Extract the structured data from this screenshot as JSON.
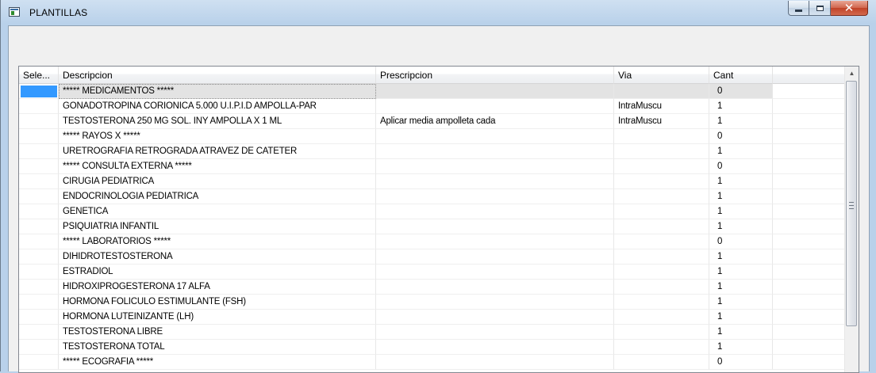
{
  "window": {
    "title": "PLANTILLAS",
    "icon": "application-window-icon",
    "controls": {
      "minimize": "minimize-icon",
      "maximize": "maximize-icon",
      "close": "close-icon"
    }
  },
  "grid": {
    "columns": [
      "Sele...",
      "Descripcion",
      "Prescripcion",
      "Via",
      "Cant"
    ],
    "selected_row": 0,
    "rows": [
      {
        "descripcion": "*****  MEDICAMENTOS  *****",
        "prescripcion": "",
        "via": "",
        "cant": "0"
      },
      {
        "descripcion": "GONADOTROPINA CORIONICA 5.000 U.I.P.I.D AMPOLLA-PAR",
        "prescripcion": "",
        "via": "IntraMuscu",
        "cant": "1"
      },
      {
        "descripcion": "TESTOSTERONA 250 MG SOL. INY AMPOLLA X 1 ML",
        "prescripcion": "Aplicar media ampolleta cada",
        "via": "IntraMuscu",
        "cant": "1"
      },
      {
        "descripcion": "*****  RAYOS X  *****",
        "prescripcion": "",
        "via": "",
        "cant": "0"
      },
      {
        "descripcion": "URETROGRAFIA RETROGRADA ATRAVEZ DE CATETER",
        "prescripcion": "",
        "via": "",
        "cant": "1"
      },
      {
        "descripcion": "*****  CONSULTA EXTERNA  *****",
        "prescripcion": "",
        "via": "",
        "cant": "0"
      },
      {
        "descripcion": "CIRUGIA PEDIATRICA",
        "prescripcion": "",
        "via": "",
        "cant": "1"
      },
      {
        "descripcion": "ENDOCRINOLOGIA PEDIATRICA",
        "prescripcion": "",
        "via": "",
        "cant": "1"
      },
      {
        "descripcion": "GENETICA",
        "prescripcion": "",
        "via": "",
        "cant": "1"
      },
      {
        "descripcion": "PSIQUIATRIA INFANTIL",
        "prescripcion": "",
        "via": "",
        "cant": "1"
      },
      {
        "descripcion": "*****  LABORATORIOS  *****",
        "prescripcion": "",
        "via": "",
        "cant": "0"
      },
      {
        "descripcion": "DIHIDROTESTOSTERONA",
        "prescripcion": "",
        "via": "",
        "cant": "1"
      },
      {
        "descripcion": "ESTRADIOL",
        "prescripcion": "",
        "via": "",
        "cant": "1"
      },
      {
        "descripcion": "HIDROXIPROGESTERONA 17 ALFA",
        "prescripcion": "",
        "via": "",
        "cant": "1"
      },
      {
        "descripcion": "HORMONA FOLICULO ESTIMULANTE (FSH)",
        "prescripcion": "",
        "via": "",
        "cant": "1"
      },
      {
        "descripcion": "HORMONA LUTEINIZANTE (LH)",
        "prescripcion": "",
        "via": "",
        "cant": "1"
      },
      {
        "descripcion": "TESTOSTERONA LIBRE",
        "prescripcion": "",
        "via": "",
        "cant": "1"
      },
      {
        "descripcion": "TESTOSTERONA TOTAL",
        "prescripcion": "",
        "via": "",
        "cant": "1"
      },
      {
        "descripcion": "*****  ECOGRAFIA  *****",
        "prescripcion": "",
        "via": "",
        "cant": "0"
      }
    ]
  },
  "scrollbar": {
    "up_icon": "scroll-up-arrow-icon",
    "grip_icon": "scroll-grip-icon"
  },
  "colors": {
    "selection": "#3399ff",
    "selected_row": "#e3e3e3",
    "window_frame": "#b9d1ea"
  }
}
